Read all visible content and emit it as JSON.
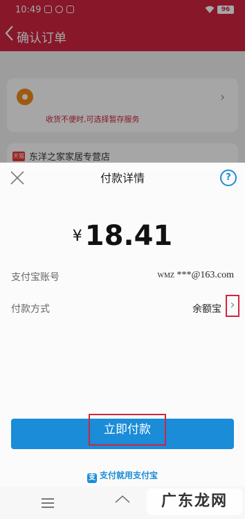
{
  "status_bar": {
    "time": "10:49",
    "battery": "96"
  },
  "header": {
    "back_icon": "chevron-left-icon",
    "title": "确认订单"
  },
  "background": {
    "address_note": "收货不便时,可选择暂存服务",
    "store_badge": "天猫",
    "store_name": "东洋之家家居专营店"
  },
  "pay_sheet": {
    "title": "付款详情",
    "close_icon": "close-icon",
    "help_label": "?",
    "currency": "¥",
    "amount": "18.41",
    "account_label": "支付宝账号",
    "account_prefix": "WMZ",
    "account_value": "***@163.com",
    "method_label": "付款方式",
    "method_value": "余额宝",
    "pay_button": "立即付款",
    "brand_text": "支付就用支付宝",
    "brand_logo": "支"
  },
  "watermark": "广东龙网",
  "colors": {
    "brand_red": "#d0243f",
    "alipay_blue": "#1a8cd8",
    "highlight": "#d0243f"
  }
}
